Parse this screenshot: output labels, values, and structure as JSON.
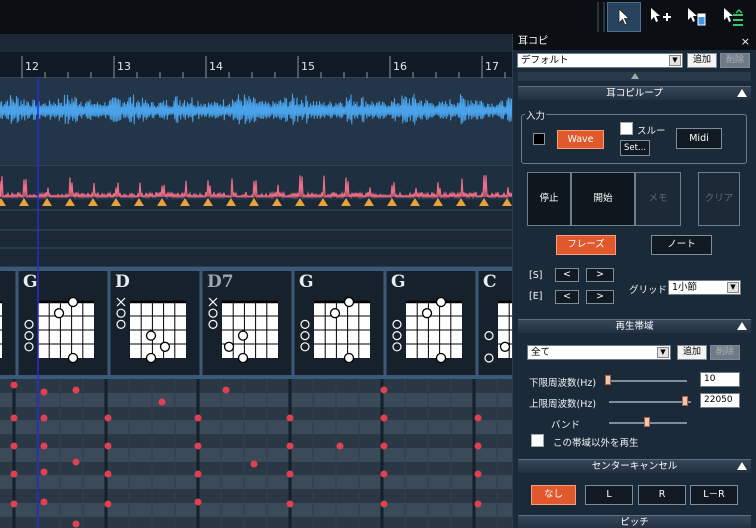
{
  "toolbar": {
    "icons": [
      "select-arrow-icon",
      "add-note-icon",
      "eraser-icon",
      "split-note-icon"
    ]
  },
  "timeline": {
    "bars": [
      "12",
      "13",
      "14",
      "15",
      "16",
      "17"
    ]
  },
  "chords": [
    {
      "name": "G"
    },
    {
      "name": "D"
    },
    {
      "name": "D7"
    },
    {
      "name": "G"
    },
    {
      "name": "G"
    },
    {
      "name": "C"
    }
  ],
  "colors": {
    "wave_blue": "#4aa3ea",
    "wave_pink": "#ee6e86",
    "beat_marker": "#e8a23a",
    "accent_orange": "#e0582c",
    "playhead": "#2a2ad8"
  },
  "panel": {
    "title": "耳コピ",
    "close": "×",
    "preset": {
      "value": "デフォルト",
      "add": "追加",
      "delete": "削除"
    },
    "loop_section": "耳コピループ",
    "input": {
      "group_label": "入力",
      "wave": "Wave",
      "through": "スルー",
      "midi": "Midi",
      "set": "Set..."
    },
    "transport": {
      "stop": "停止",
      "start": "開始",
      "memo": "メモ",
      "clear": "クリア"
    },
    "mode": {
      "phrase": "フレーズ",
      "note": "ノート"
    },
    "range": {
      "s": "[S]",
      "e": "[E]",
      "prev": "<",
      "next": ">",
      "grid_label": "グリッド",
      "grid_value": "1小節"
    },
    "band_section": "再生帯域",
    "band": {
      "preset": "全て",
      "add": "追加",
      "delete": "削除",
      "low_label": "下限周波数(Hz)",
      "low_value": "10",
      "high_label": "上限周波数(Hz)",
      "high_value": "22050",
      "band_label": "バンド",
      "outside_label": "この帯域以外を再生"
    },
    "center_section": "センターキャンセル",
    "center": {
      "none": "なし",
      "l": "L",
      "r": "R",
      "lr": "L－R"
    },
    "pitch_section": "ピッチ"
  }
}
